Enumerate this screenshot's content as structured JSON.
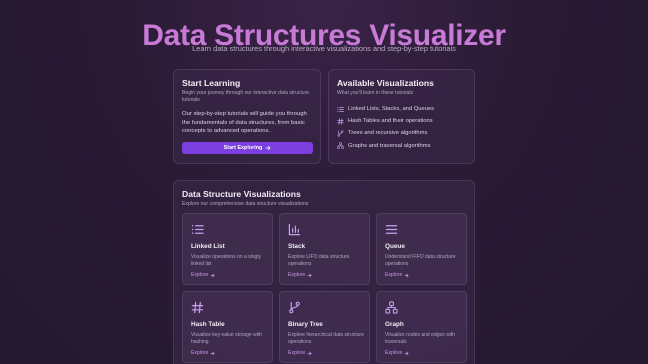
{
  "header": {
    "title": "Data Structures Visualizer",
    "subtitle": "Learn data structures through interactive visualizations and step-by-step tutorials"
  },
  "start_card": {
    "title": "Start Learning",
    "description": "Begin your journey through our interactive data structure tutorials",
    "body": "Our step-by-step tutorials will guide you through the fundamentals of data structures, from basic concepts to advanced operations.",
    "button_label": "Start Exploring"
  },
  "available_card": {
    "title": "Available Visualizations",
    "description": "What you'll learn in these tutorials",
    "items": [
      {
        "label": "Linked Lists, Stacks, and Queues",
        "icon": "list-icon"
      },
      {
        "label": "Hash Tables and their operations",
        "icon": "hash-icon"
      },
      {
        "label": "Trees and recursive algorithms",
        "icon": "git-branch-icon"
      },
      {
        "label": "Graphs and traversal algorithms",
        "icon": "network-icon"
      }
    ]
  },
  "viz_section": {
    "title": "Data Structure Visualizations",
    "description": "Explore our comprehensive data structure visualizations",
    "tiles": [
      {
        "name": "Linked List",
        "description": "Visualize operations on a singly linked list",
        "link": "Explore",
        "icon": "list-icon"
      },
      {
        "name": "Stack",
        "description": "Explore LIFO data structure operations",
        "link": "Explore",
        "icon": "bar-chart-icon"
      },
      {
        "name": "Queue",
        "description": "Understand FIFO data structure operations",
        "link": "Explore",
        "icon": "menu-icon"
      },
      {
        "name": "Hash Table",
        "description": "Visualize key-value storage with hashing",
        "link": "Explore",
        "icon": "hash-icon"
      },
      {
        "name": "Binary Tree",
        "description": "Explore hierarchical data structure operations",
        "link": "Explore",
        "icon": "git-branch-icon"
      },
      {
        "name": "Graph",
        "description": "Visualize nodes and edges with traversals",
        "link": "Explore",
        "icon": "network-icon"
      }
    ]
  },
  "colors": {
    "accent": "#c77bd6",
    "button": "#7b3fe0",
    "link": "#c896ea",
    "icon": "#c9a0f0"
  }
}
